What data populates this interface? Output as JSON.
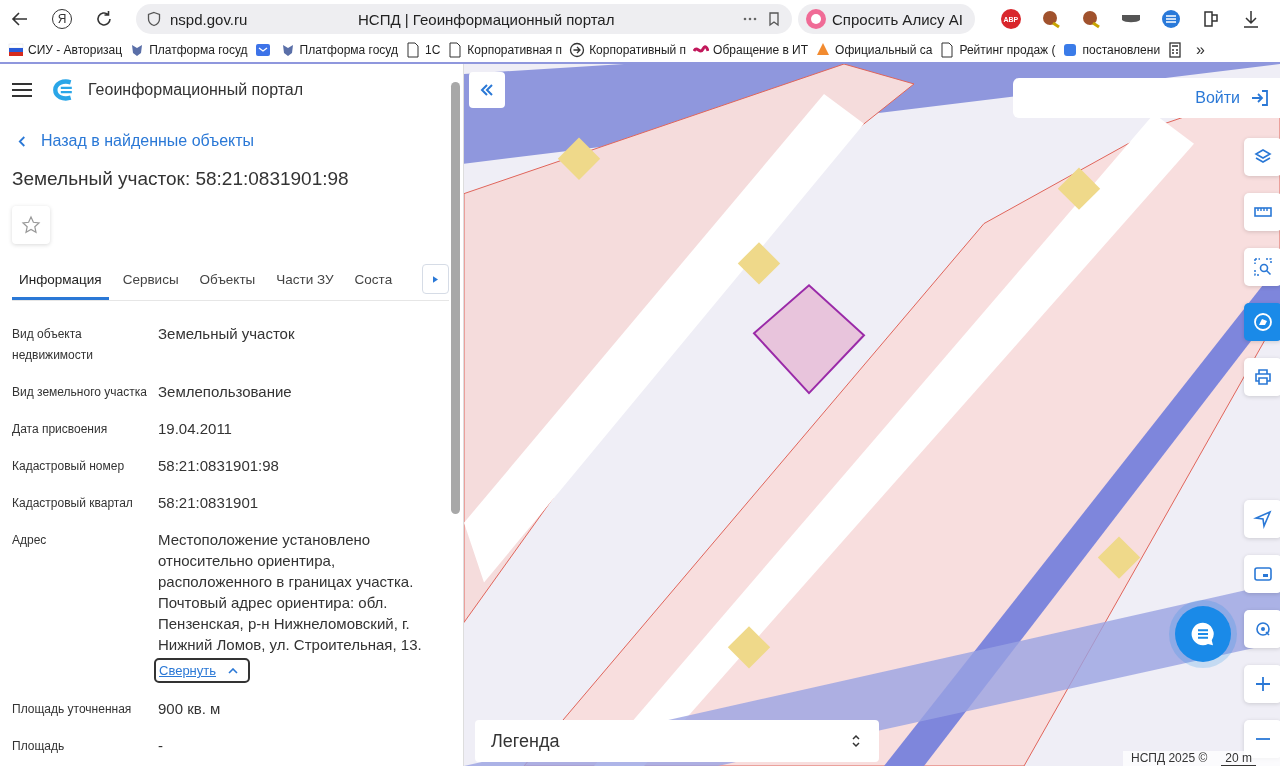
{
  "browser": {
    "home_glyph": "Я",
    "url": "nspd.gov.ru",
    "tab_title": "НСПД | Геоинформационный портал",
    "alice_button": "Спросить Алису AI",
    "abp_label": "ABP",
    "bookmarks": [
      "СИУ - Авторизац",
      "Платформа госуд",
      "Платформа госуд",
      "1С",
      "Корпоративная п",
      "Корпоративный п",
      "Обращение в ИТ",
      "Официальный са",
      "Рейтинг продаж (",
      "постановлени"
    ],
    "more_glyph": "»"
  },
  "panel": {
    "app_title": "Геоинформационный портал",
    "back_link": "Назад в найденные объекты",
    "title": "Земельный участок: 58:21:0831901:98",
    "favorite": false,
    "tabs": [
      {
        "label": "Информация",
        "selected": true
      },
      {
        "label": "Сервисы",
        "selected": false
      },
      {
        "label": "Объекты",
        "selected": false
      },
      {
        "label": "Части ЗУ",
        "selected": false
      },
      {
        "label": "Соста",
        "selected": false
      }
    ],
    "fields": [
      {
        "label": "Вид объекта недвижимости",
        "value": "Земельный участок"
      },
      {
        "label": "Вид земельного участка",
        "value": "Землепользование"
      },
      {
        "label": "Дата присвоения",
        "value": "19.04.2011"
      },
      {
        "label": "Кадастровый номер",
        "value": "58:21:0831901:98"
      },
      {
        "label": "Кадастровый квартал",
        "value": "58:21:0831901"
      },
      {
        "label": "Адрес",
        "value": "Местоположение установлено относительно ориентира, расположенного в границах участка. Почтовый адрес ориентира: обл. Пензенская, р-н Нижнеломовский, г. Нижний Ломов, ул. Строительная, 13.",
        "collapse_link": "Свернуть"
      },
      {
        "label": "Площадь уточненная",
        "value": "900 кв. м"
      },
      {
        "label": "Площадь",
        "value": "-"
      }
    ]
  },
  "map": {
    "login_button": "Войти",
    "legend": "Легенда",
    "attribution": "НСПД 2025 ©",
    "scale": "20 m"
  }
}
